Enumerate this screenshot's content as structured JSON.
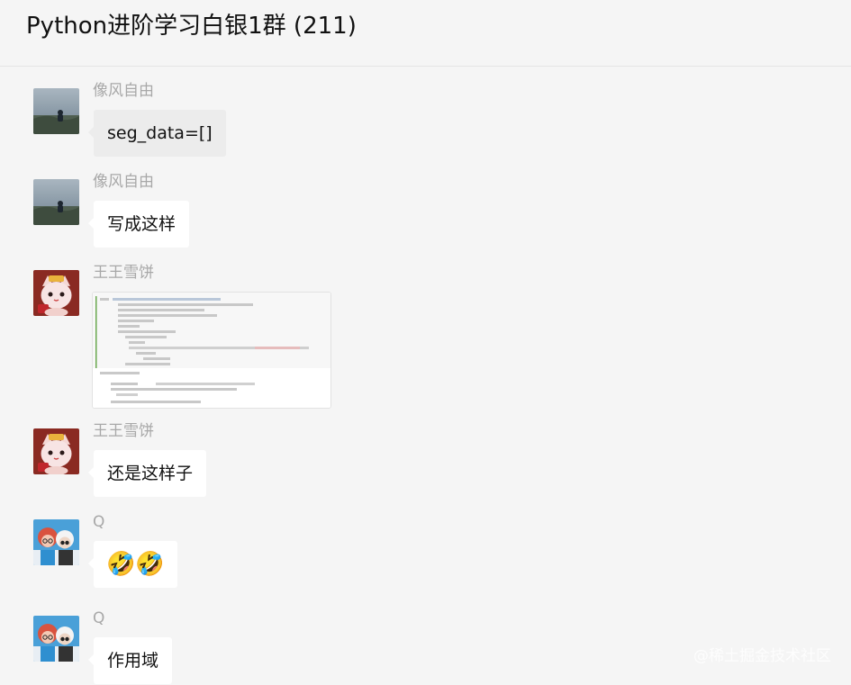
{
  "header": {
    "title": "Python进阶学习白银1群 (211)"
  },
  "messages": [
    {
      "sender": "像风自由",
      "avatar": "landscape-avatar",
      "text": "seg_data=[]"
    },
    {
      "sender": "像风自由",
      "avatar": "landscape-avatar",
      "text": "写成这样"
    },
    {
      "sender": "王王雪饼",
      "avatar": "cat-avatar",
      "type": "image",
      "image": "code-screenshot"
    },
    {
      "sender": "王王雪饼",
      "avatar": "cat-avatar",
      "text": "还是这样子"
    },
    {
      "sender": "Q",
      "avatar": "cartoon-couple-avatar",
      "text": "🤣🤣"
    },
    {
      "sender": "Q",
      "avatar": "cartoon-couple-avatar",
      "text": "作用域"
    }
  ],
  "watermark": "@稀土掘金技术社区"
}
